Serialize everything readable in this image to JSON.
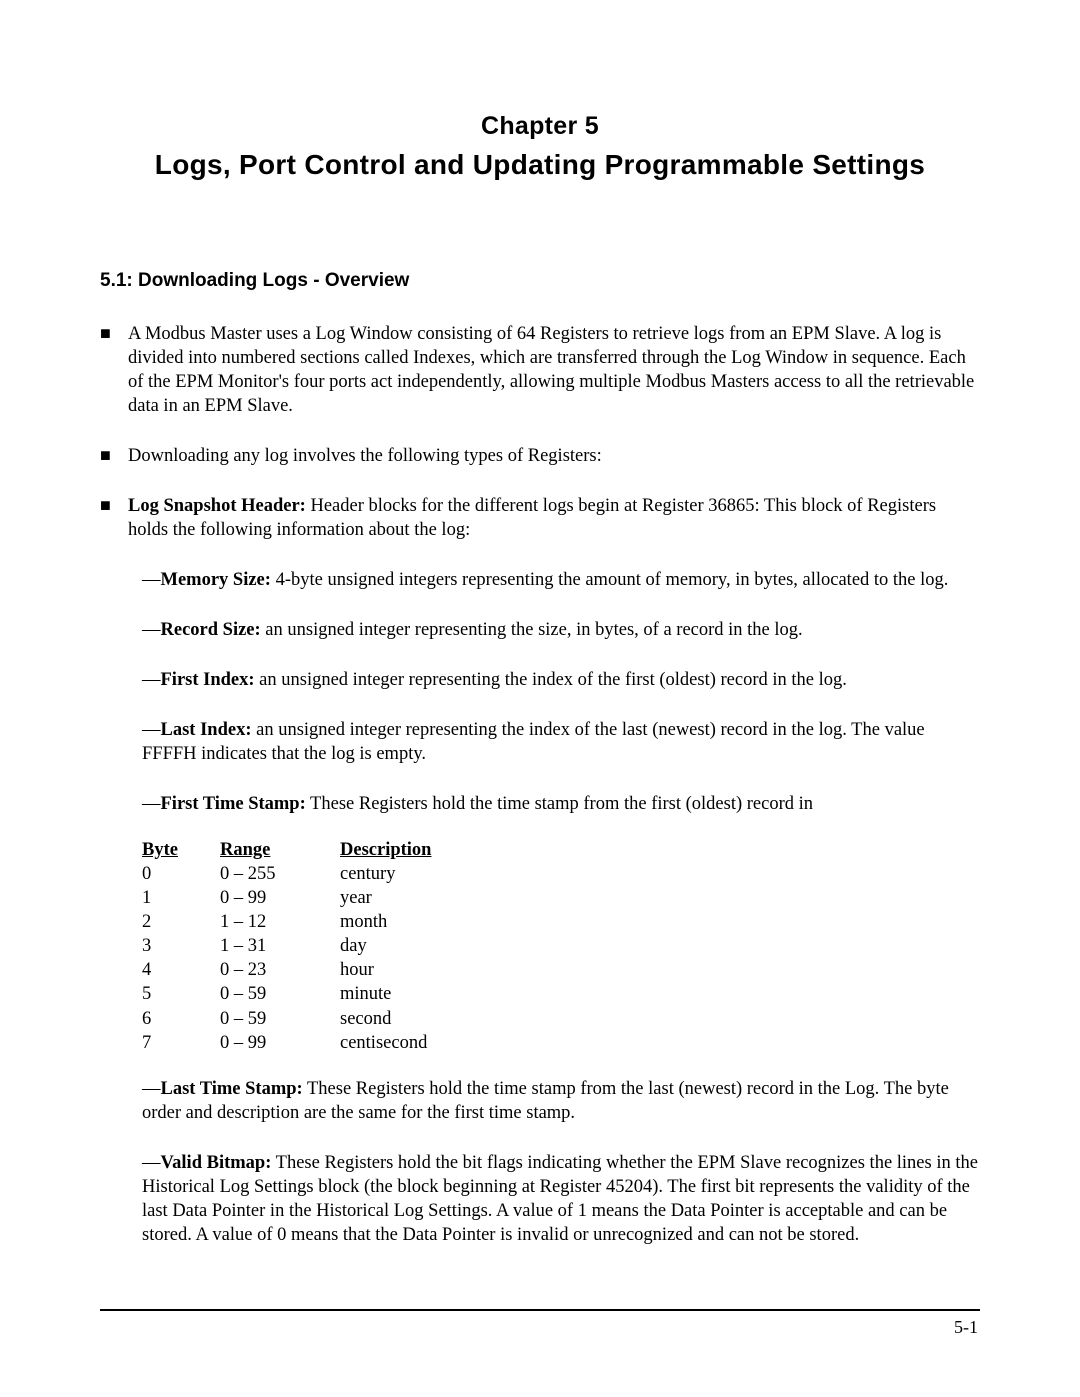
{
  "chapter": {
    "line": "Chapter 5",
    "title": "Logs, Port Control and Updating Programmable Settings"
  },
  "section": {
    "heading": "5.1:  Downloading Logs - Overview"
  },
  "bullets": {
    "b1": "A Modbus Master uses a Log Window consisting of 64 Registers to retrieve logs from an EPM Slave. A log is divided into numbered sections called Indexes, which are transferred through the Log Window in sequence. Each of the EPM Monitor's four ports act independently, allowing multiple Modbus Masters access to all the retrievable data in an EPM Slave.",
    "b2": "Downloading any log involves the following types of Registers:",
    "b3_label": "Log Snapshot Header:",
    "b3_rest": " Header blocks for the different logs begin at Register 36865: This block of Registers holds the following information about the log:"
  },
  "subs": {
    "mem_label": "Memory Size:",
    "mem_rest": " 4-byte unsigned integers representing the amount of memory, in bytes, allocated to the log.",
    "rec_label": "Record Size:",
    "rec_rest": " an unsigned integer representing the size, in bytes, of a record in the log.",
    "first_idx_label": "First Index:",
    "first_idx_rest": " an unsigned integer representing the index of the first (oldest) record in the log.",
    "last_idx_label": "Last Index:",
    "last_idx_rest": " an unsigned integer representing the index of the last (newest) record in the log. The value FFFFH indicates that the log is empty.",
    "first_ts_label": "First Time Stamp:",
    "first_ts_rest": " These Registers hold the time stamp from the first (oldest) record in",
    "last_ts_label": "Last Time Stamp:",
    "last_ts_rest": "  These Registers hold the time stamp from the last (newest) record in the Log. The byte order and description are the same for the first time stamp.",
    "valid_label": "Valid Bitmap:",
    "valid_rest": "  These Registers hold the bit flags indicating whether the EPM Slave recognizes the lines in the Historical Log Settings block (the block beginning at Register 45204). The first bit represents the validity of the last Data Pointer in the Historical Log Settings. A value of 1 means the Data Pointer is acceptable and can be stored.  A value of 0 means that the Data Pointer is invalid or unrecognized and can not be stored."
  },
  "ts_table": {
    "h_byte": "Byte",
    "h_range": "Range",
    "h_desc": "Description",
    "rows": [
      {
        "byte": "0",
        "range": "0 – 255",
        "desc": "century"
      },
      {
        "byte": "1",
        "range": "0 – 99",
        "desc": "year"
      },
      {
        "byte": "2",
        "range": "1 – 12",
        "desc": "month"
      },
      {
        "byte": "3",
        "range": "1 – 31",
        "desc": "day"
      },
      {
        "byte": "4",
        "range": "0 – 23",
        "desc": "hour"
      },
      {
        "byte": "5",
        "range": "0 – 59",
        "desc": "minute"
      },
      {
        "byte": "6",
        "range": "0 – 59",
        "desc": "second"
      },
      {
        "byte": "7",
        "range": "0 – 99",
        "desc": "centisecond"
      }
    ]
  },
  "page_number": "5-1"
}
